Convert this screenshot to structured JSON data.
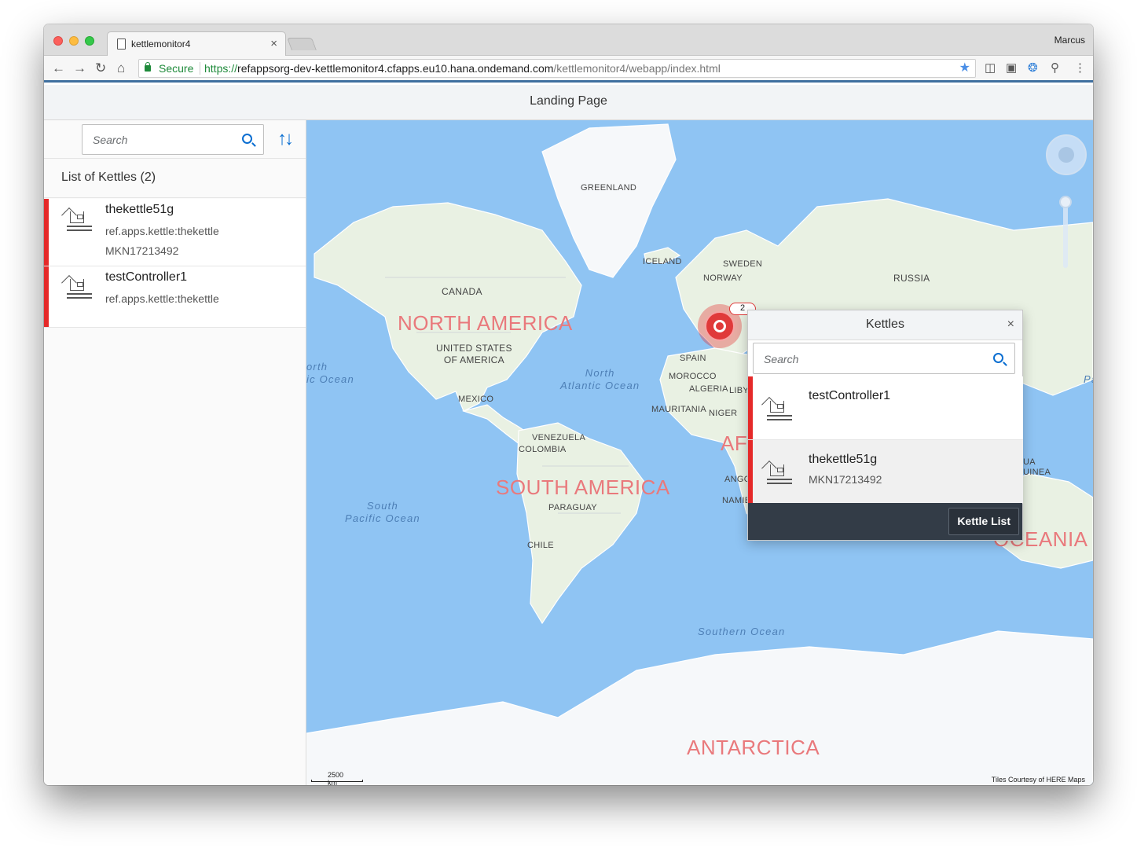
{
  "browser": {
    "tab_title": "kettlemonitor4",
    "tab_close": "×",
    "profile_name": "Marcus",
    "secure_label": "Secure",
    "url_scheme": "https://",
    "url_host": "refappsorg-dev-kettlemonitor4.cfapps.eu10.hana.ondemand.com",
    "url_path": "/kettlemonitor4/webapp/index.html",
    "nav_icons": [
      "back-arrow-icon",
      "forward-arrow-icon",
      "reload-icon",
      "home-icon"
    ],
    "toolbar_icons": [
      "bookmark-star-icon",
      "pocket-icon",
      "screenshot-icon",
      "extension-icon",
      "key-icon",
      "menu-dots-icon"
    ]
  },
  "page": {
    "header_title": "Landing Page"
  },
  "sidebar": {
    "search_placeholder": "Search",
    "sort_icon": "sort-icon",
    "list_title": "List of Kettles (2)",
    "items": [
      {
        "name": "thekettle51g",
        "type": "ref.apps.kettle:thekettle",
        "serial": "MKN17213492",
        "status_color": "#e52929"
      },
      {
        "name": "testController1",
        "type": "ref.apps.kettle:thekettle",
        "serial": "",
        "status_color": "#e52929"
      }
    ]
  },
  "map": {
    "labels": {
      "greenland": "GREENLAND",
      "iceland": "ICELAND",
      "sweden": "SWEDEN",
      "norway": "NORWAY",
      "russia": "RUSSIA",
      "canada": "CANADA",
      "usa": "UNITED STATES\nOF AMERICA",
      "mexico": "MEXICO",
      "spain": "SPAIN",
      "morocco": "MOROCCO",
      "algeria": "ALGERIA",
      "libya": "LIBY",
      "mauritania": "MAURITANIA",
      "niger": "NIGER",
      "venezuela": "VENEZUELA",
      "colombia": "COLOMBIA",
      "paraguay": "PARAGUAY",
      "chile": "CHILE",
      "angola": "ANGO",
      "namibia": "NAMIB",
      "papua": "UA\nUINEA"
    },
    "continents": {
      "north_america": "NORTH AMERICA",
      "south_america": "SOUTH AMERICA",
      "antarctica": "ANTARCTICA",
      "oceania": "OCEANIA",
      "africa": "AF"
    },
    "oceans": {
      "north_pacific": "orth\nic Ocean",
      "north_atlantic": "North\nAtlantic Ocean",
      "south_pacific": "South\nPacific Ocean",
      "southern": "Southern Ocean",
      "pacific_edge": "Pa"
    },
    "scale": "2500 km",
    "attribution": "Tiles Courtesy of HERE Maps",
    "cluster_count": "2",
    "navigation_icon": "map-navigation-icon"
  },
  "popover": {
    "title": "Kettles",
    "close": "×",
    "search_placeholder": "Search",
    "items": [
      {
        "name": "testController1",
        "serial": "",
        "status_color": "#e52929"
      },
      {
        "name": "thekettle51g",
        "serial": "MKN17213492",
        "status_color": "#e52929"
      }
    ],
    "footer_button": "Kettle List"
  }
}
